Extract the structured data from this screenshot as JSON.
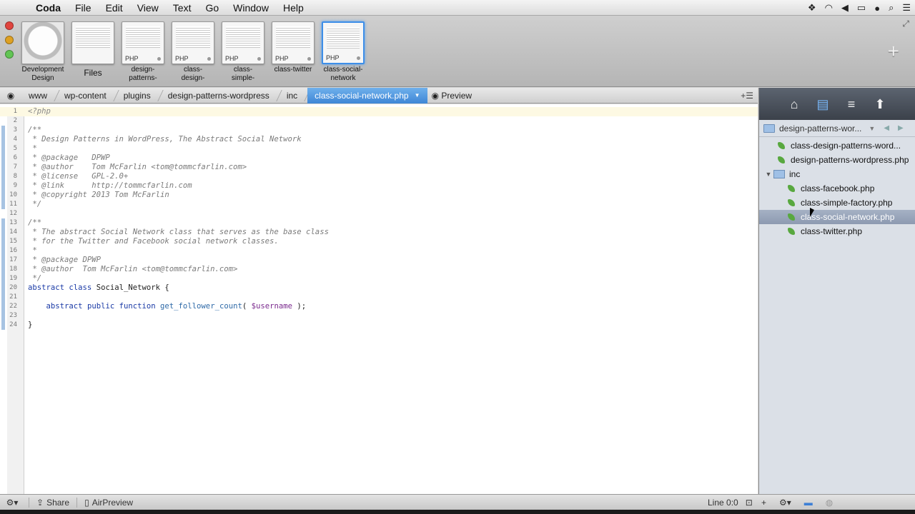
{
  "menubar": {
    "app": "Coda",
    "items": [
      "File",
      "Edit",
      "View",
      "Text",
      "Go",
      "Window",
      "Help"
    ]
  },
  "sites": [
    {
      "label": "Development\nDesign",
      "kind": "globe"
    },
    {
      "label": "Files",
      "kind": "files"
    },
    {
      "label": "design-\npatterns-",
      "tag": "PHP"
    },
    {
      "label": "class-\ndesign-",
      "tag": "PHP"
    },
    {
      "label": "class-\nsimple-",
      "tag": "PHP"
    },
    {
      "label": "class-twitter",
      "tag": "PHP"
    },
    {
      "label": "class-social-\nnetwork",
      "tag": "PHP",
      "selected": true
    }
  ],
  "pathbar": {
    "crumbs": [
      "www",
      "wp-content",
      "plugins",
      "design-patterns-wordpress",
      "inc"
    ],
    "active": "class-social-network.php",
    "preview": "Preview"
  },
  "sidebar": {
    "header": "design-patterns-wor...",
    "files": [
      {
        "name": "class-design-patterns-word...",
        "depth": 1,
        "type": "php"
      },
      {
        "name": "design-patterns-wordpress.php",
        "depth": 1,
        "type": "php"
      },
      {
        "name": "inc",
        "depth": 0,
        "type": "folder"
      },
      {
        "name": "class-facebook.php",
        "depth": 2,
        "type": "php"
      },
      {
        "name": "class-simple-factory.php",
        "depth": 2,
        "type": "php"
      },
      {
        "name": "class-social-network.php",
        "depth": 2,
        "type": "php",
        "selected": true
      },
      {
        "name": "class-twitter.php",
        "depth": 2,
        "type": "php"
      }
    ]
  },
  "code": [
    "<?php",
    "",
    "/**",
    " * Design Patterns in WordPress, The Abstract Social Network",
    " *",
    " * @package   DPWP",
    " * @author    Tom McFarlin <tom@tommcfarlin.com>",
    " * @license   GPL-2.0+",
    " * @link      http://tommcfarlin.com",
    " * @copyright 2013 Tom McFarlin",
    " */",
    "",
    "/**",
    " * The abstract Social Network class that serves as the base class",
    " * for the Twitter and Facebook social network classes.",
    " *",
    " * @package DPWP",
    " * @author  Tom McFarlin <tom@tommcfarlin.com>",
    " */",
    "abstract class Social_Network {",
    "",
    "    abstract public function get_follower_count( $username );",
    "",
    "}"
  ],
  "status": {
    "share": "Share",
    "airpreview": "AirPreview",
    "line": "Line 0:0"
  }
}
